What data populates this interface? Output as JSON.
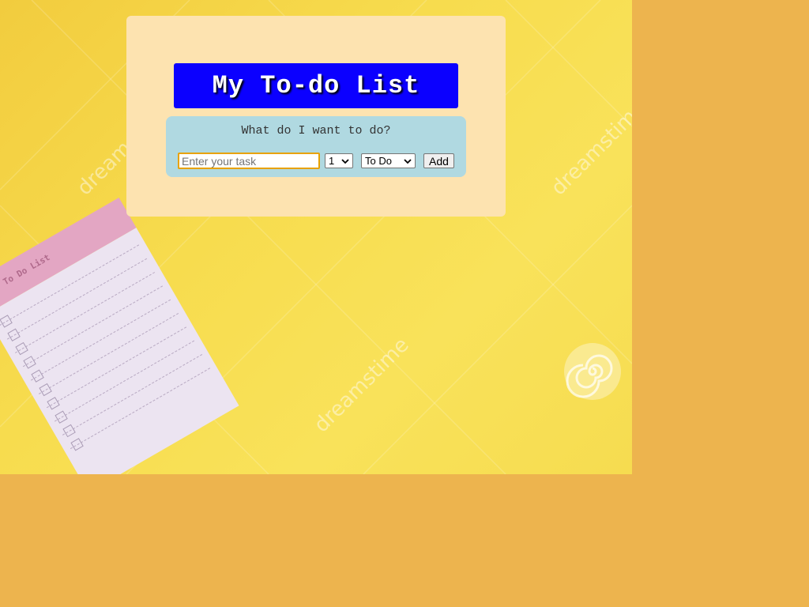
{
  "header": {
    "title": "My To-do List"
  },
  "form": {
    "question": "What do I want to do?",
    "task_placeholder": "Enter your task",
    "task_value": "",
    "priority_selected": "1",
    "status_selected": "To Do",
    "add_label": "Add"
  },
  "background": {
    "notepad_label": "To Do List",
    "watermark_text": "dreamstime",
    "page_color": "#edb44e",
    "image_color": "#f7dc4e"
  },
  "colors": {
    "card": "#fde3b0",
    "title_bg": "#0b00ff",
    "form_bg": "#b0d9e1",
    "input_focus": "#e8a200"
  }
}
